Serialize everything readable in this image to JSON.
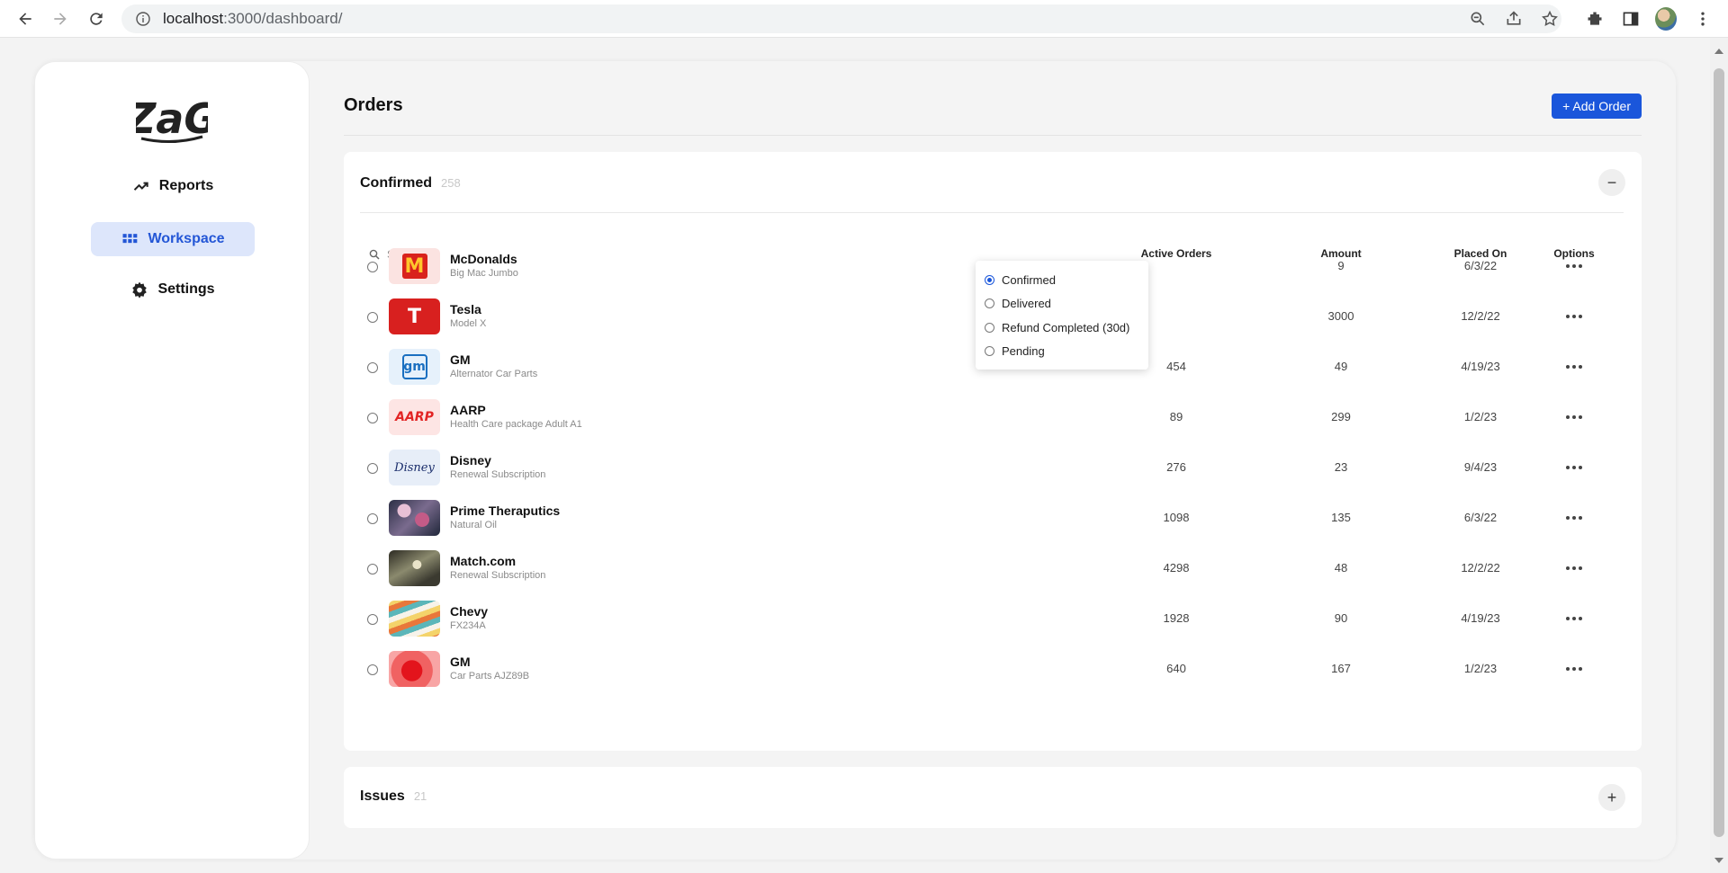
{
  "browser": {
    "url_host": "localhost",
    "url_rest": ":3000/dashboard/"
  },
  "sidebar": {
    "logo_text": "ZaG",
    "items": [
      {
        "label": "Reports",
        "icon": "trending-up-icon",
        "active": false
      },
      {
        "label": "Workspace",
        "icon": "grid-icon",
        "active": true
      },
      {
        "label": "Settings",
        "icon": "gear-icon",
        "active": false
      }
    ]
  },
  "header": {
    "title": "Orders",
    "add_button_label": "+ Add Order"
  },
  "confirmed": {
    "title": "Confirmed",
    "count": "258",
    "search_placeholder": "Search",
    "columns": [
      "Active Orders",
      "Amount",
      "Placed On",
      "Options"
    ],
    "rows": [
      {
        "name": "McDonalds",
        "sub": "Big Mac Jumbo",
        "active_orders": "",
        "amount": "9",
        "placed_on": "6/3/22",
        "thumb": "mcdonalds"
      },
      {
        "name": "Tesla",
        "sub": "Model X",
        "active_orders": "",
        "amount": "3000",
        "placed_on": "12/2/22",
        "thumb": "tesla"
      },
      {
        "name": "GM",
        "sub": "Alternator Car Parts",
        "active_orders": "454",
        "amount": "49",
        "placed_on": "4/19/23",
        "thumb": "gm"
      },
      {
        "name": "AARP",
        "sub": "Health Care package Adult A1",
        "active_orders": "89",
        "amount": "299",
        "placed_on": "1/2/23",
        "thumb": "aarp"
      },
      {
        "name": "Disney",
        "sub": "Renewal Subscription",
        "active_orders": "276",
        "amount": "23",
        "placed_on": "9/4/23",
        "thumb": "disney"
      },
      {
        "name": "Prime Theraputics",
        "sub": "Natural Oil",
        "active_orders": "1098",
        "amount": "135",
        "placed_on": "6/3/22",
        "thumb": "prime"
      },
      {
        "name": "Match.com",
        "sub": "Renewal Subscription",
        "active_orders": "4298",
        "amount": "48",
        "placed_on": "12/2/22",
        "thumb": "match"
      },
      {
        "name": "Chevy",
        "sub": "FX234A",
        "active_orders": "1928",
        "amount": "90",
        "placed_on": "4/19/23",
        "thumb": "chevy"
      },
      {
        "name": "GM",
        "sub": "Car Parts AJZ89B",
        "active_orders": "640",
        "amount": "167",
        "placed_on": "1/2/23",
        "thumb": "gm2"
      }
    ]
  },
  "status_dropdown": {
    "options": [
      {
        "label": "Confirmed",
        "selected": true
      },
      {
        "label": "Delivered",
        "selected": false
      },
      {
        "label": "Refund Completed (30d)",
        "selected": false
      },
      {
        "label": "Pending",
        "selected": false
      }
    ]
  },
  "issues": {
    "title": "Issues",
    "count": "21"
  },
  "colors": {
    "accent": "#1a56db",
    "active_nav_bg": "#dde6fb",
    "active_nav_text": "#2356d6"
  }
}
